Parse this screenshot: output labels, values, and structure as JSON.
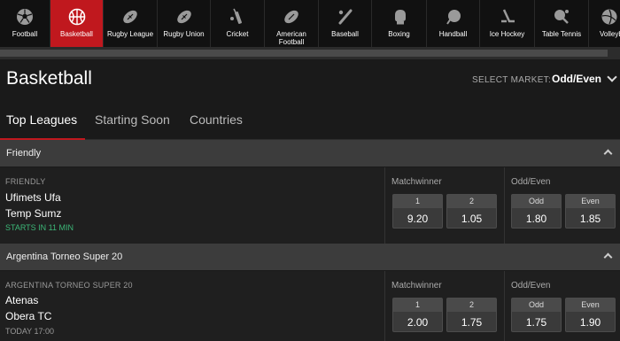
{
  "sports": [
    {
      "label": "Football",
      "icon": "soccer-ball-icon",
      "active": false
    },
    {
      "label": "Basketball",
      "icon": "basketball-icon",
      "active": true
    },
    {
      "label": "Rugby League",
      "icon": "rugby-ball-icon",
      "active": false
    },
    {
      "label": "Rugby Union",
      "icon": "rugby-ball-icon",
      "active": false
    },
    {
      "label": "Cricket",
      "icon": "cricket-bat-icon",
      "active": false
    },
    {
      "label": "American Football",
      "icon": "american-football-icon",
      "active": false
    },
    {
      "label": "Baseball",
      "icon": "baseball-bat-icon",
      "active": false
    },
    {
      "label": "Boxing",
      "icon": "boxing-glove-icon",
      "active": false
    },
    {
      "label": "Handball",
      "icon": "handball-icon",
      "active": false
    },
    {
      "label": "Ice Hockey",
      "icon": "hockey-stick-icon",
      "active": false
    },
    {
      "label": "Table Tennis",
      "icon": "table-tennis-icon",
      "active": false
    },
    {
      "label": "Volleyball",
      "icon": "volleyball-icon",
      "active": false
    }
  ],
  "page": {
    "title": "Basketball",
    "market_label": "SELECT MARKET:",
    "market_value": "Odd/Even"
  },
  "tabs": [
    {
      "label": "Top Leagues",
      "active": true
    },
    {
      "label": "Starting Soon",
      "active": false
    },
    {
      "label": "Countries",
      "active": false
    }
  ],
  "leagues": [
    {
      "name": "Friendly",
      "event": {
        "competition": "FRIENDLY",
        "home": "Ufimets Ufa",
        "away": "Temp Sumz",
        "status": "STARTS IN 11 MIN",
        "matchwinner_title": "Matchwinner",
        "oddeven_title": "Odd/Even",
        "matchwinner": [
          {
            "label": "1",
            "value": "9.20"
          },
          {
            "label": "2",
            "value": "1.05"
          }
        ],
        "oddeven": [
          {
            "label": "Odd",
            "value": "1.80"
          },
          {
            "label": "Even",
            "value": "1.85"
          }
        ]
      }
    },
    {
      "name": "Argentina Torneo Super 20",
      "event": {
        "competition": "ARGENTINA TORNEO SUPER 20",
        "home": "Atenas",
        "away": "Obera TC",
        "status": "TODAY 17:00",
        "matchwinner_title": "Matchwinner",
        "oddeven_title": "Odd/Even",
        "matchwinner": [
          {
            "label": "1",
            "value": "2.00"
          },
          {
            "label": "2",
            "value": "1.75"
          }
        ],
        "oddeven": [
          {
            "label": "Odd",
            "value": "1.75"
          },
          {
            "label": "Even",
            "value": "1.90"
          }
        ]
      }
    }
  ],
  "colors": {
    "accent": "#c0181e",
    "status_green": "#3cb878"
  }
}
